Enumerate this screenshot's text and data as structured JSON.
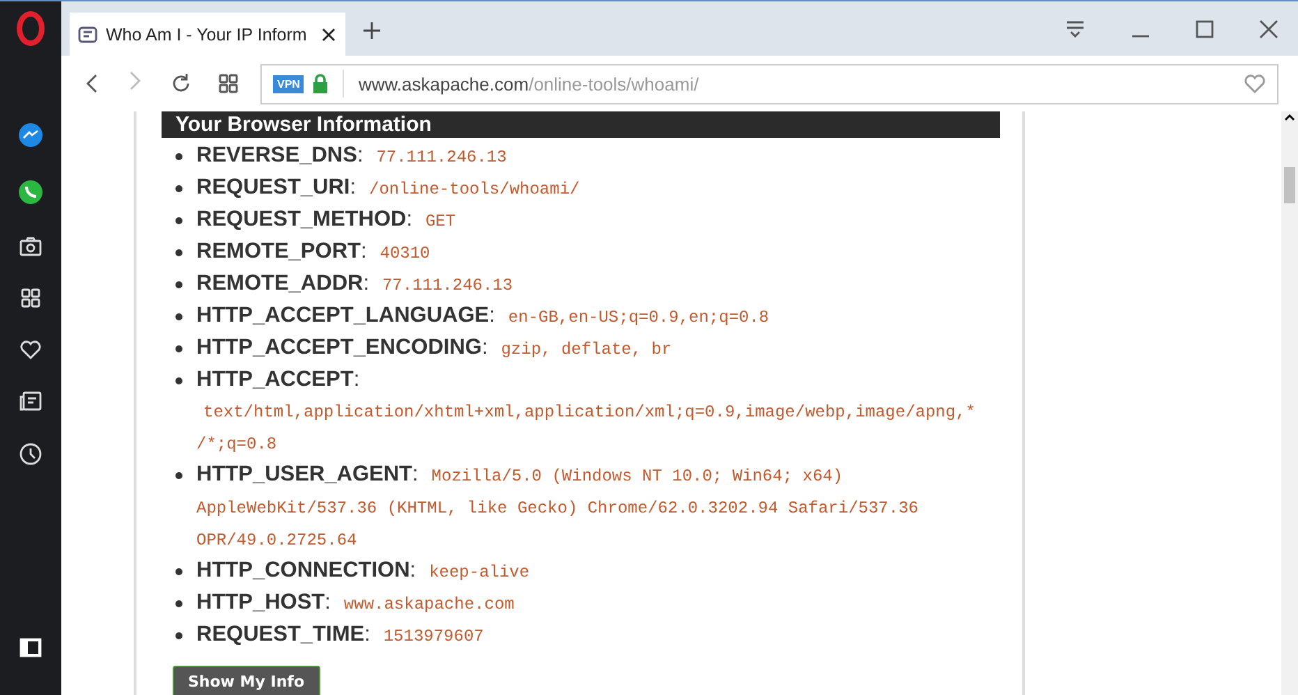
{
  "tab": {
    "title": "Who Am I - Your IP Inform",
    "selected": true
  },
  "address": {
    "vpn_badge": "VPN",
    "domain": "www.askapache.com",
    "path": "/online-tools/whoami/"
  },
  "page": {
    "heading": "Your Browser Information",
    "items": [
      {
        "label": "**REVERSE_DNS**:",
        "value": "77.111.246.13"
      },
      {
        "label": "**REQUEST_URI**:",
        "value": "/online-tools/whoami/"
      },
      {
        "label": "**REQUEST_METHOD**:",
        "value": "GET"
      },
      {
        "label": "**REMOTE_PORT**:",
        "value": "40310"
      },
      {
        "label": "**REMOTE_ADDR**:",
        "value": "77.111.246.13"
      },
      {
        "label": "**HTTP_ACCEPT_LANGUAGE**:",
        "value": "en-GB,en-US;q=0.9,en;q=0.8"
      },
      {
        "label": "**HTTP_ACCEPT_ENCODING**:",
        "value": "gzip, deflate, br"
      },
      {
        "label": "**HTTP_ACCEPT**:",
        "value": "text/html,application/xhtml+xml,application/xml;q=0.9,image/webp,image/apng,*/*;q=0.8"
      },
      {
        "label": "**HTTP_USER_AGENT**:",
        "value": "Mozilla/5.0 (Windows NT 10.0; Win64; x64) AppleWebKit/537.36 (KHTML, like Gecko) Chrome/62.0.3202.94 Safari/537.36 OPR/49.0.2725.64"
      },
      {
        "label": "**HTTP_CONNECTION**:",
        "value": "keep-alive"
      },
      {
        "label": "**HTTP_HOST**:",
        "value": "www.askapache.com"
      },
      {
        "label": "**REQUEST_TIME**:",
        "value": "1513979607"
      }
    ],
    "button": "Show My Info"
  }
}
